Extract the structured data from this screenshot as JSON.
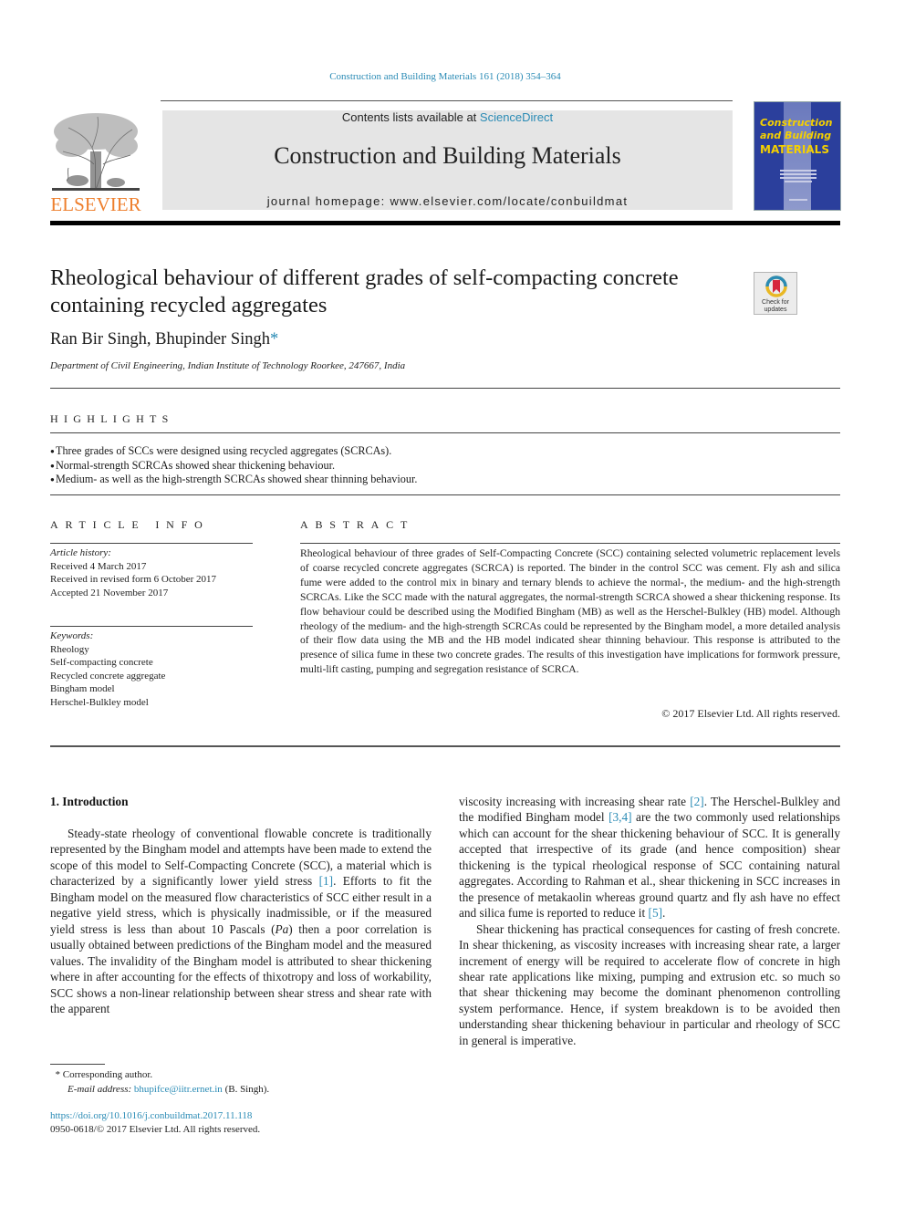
{
  "header": {
    "citation": "Construction and Building Materials 161 (2018) 354–364",
    "contents_prefix": "Contents lists available at ",
    "contents_link": "ScienceDirect",
    "journal_title": "Construction and Building Materials",
    "homepage_label": "journal homepage: ",
    "homepage_url": "www.elsevier.com/locate/conbuildmat",
    "publisher_logo_text": "ELSEVIER",
    "cover": {
      "line1": "Construction",
      "line2": "and Building",
      "line3": "MATERIALS"
    },
    "colors": {
      "link": "#2a8bb5",
      "elsevier_orange": "#ee7f2d",
      "cover_blue": "#2b3f9c",
      "cover_yellow": "#f5d000",
      "masthead_gray": "#e5e5e5"
    }
  },
  "article": {
    "title": "Rheological behaviour of different grades of self-compacting concrete containing recycled aggregates",
    "check_updates_line1": "Check for",
    "check_updates_line2": "updates",
    "authors": "Ran Bir Singh, Bhupinder Singh",
    "corresponding_mark": "*",
    "affiliation": "Department of Civil Engineering, Indian Institute of Technology Roorkee, 247667, India"
  },
  "highlights": {
    "label": "HIGHLIGHTS",
    "items": [
      "Three grades of SCCs were designed using recycled aggregates (SCRCAs).",
      "Normal-strength SCRCAs showed shear thickening behaviour.",
      "Medium- as well as the high-strength SCRCAs showed shear thinning behaviour."
    ]
  },
  "article_info": {
    "label": "ARTICLE INFO",
    "history_label": "Article history:",
    "history": [
      "Received 4 March 2017",
      "Received in revised form 6 October 2017",
      "Accepted 21 November 2017"
    ],
    "keywords_label": "Keywords:",
    "keywords": [
      "Rheology",
      "Self-compacting concrete",
      "Recycled concrete aggregate",
      "Bingham model",
      "Herschel-Bulkley model"
    ]
  },
  "abstract": {
    "label": "ABSTRACT",
    "text": "Rheological behaviour of three grades of Self-Compacting Concrete (SCC) containing selected volumetric replacement levels of coarse recycled concrete aggregates (SCRCA) is reported. The binder in the control SCC was cement. Fly ash and silica fume were added to the control mix in binary and ternary blends to achieve the normal-, the medium- and the high-strength SCRCAs. Like the SCC made with the natural aggregates, the normal-strength SCRCA showed a shear thickening response. Its flow behaviour could be described using the Modified Bingham (MB) as well as the Herschel-Bulkley (HB) model. Although rheology of the medium- and the high-strength SCRCAs could be represented by the Bingham model, a more detailed analysis of their flow data using the MB and the HB model indicated shear thinning behaviour. This response is attributed to the presence of silica fume in these two concrete grades. The results of this investigation have implications for formwork pressure, multi-lift casting, pumping and segregation resistance of SCRCA.",
    "copyright": "© 2017 Elsevier Ltd. All rights reserved."
  },
  "introduction": {
    "heading": "1. Introduction",
    "left_p1_a": "Steady-state rheology of conventional flowable concrete is traditionally represented by the Bingham model and attempts have been made to extend the scope of this model to Self-Compacting Concrete (SCC), a material which is characterized by a significantly lower yield stress ",
    "ref1": "[1]",
    "left_p1_b": ". Efforts to fit the Bingham model on the measured flow characteristics of SCC either result in a negative yield stress, which is physically inadmissible, or if the measured yield stress is less than about 10 Pascals (",
    "pa": "Pa",
    "left_p1_c": ") then a poor correlation is usually obtained between predictions of the Bingham model and the measured values. The invalidity of the Bingham model is attributed to shear thickening where in after accounting for the effects of thixotropy and loss of workability, SCC shows a non-linear relationship between shear stress and shear rate with the apparent",
    "right_p1_a": "viscosity increasing with increasing shear rate ",
    "ref2": "[2]",
    "right_p1_b": ". The Herschel-Bulkley and the modified Bingham model ",
    "ref34": "[3,4]",
    "right_p1_c": " are the two commonly used relationships which can account for the shear thickening behaviour of SCC. It is generally accepted that irrespective of its grade (and hence composition) shear thickening is the typical rheological response of SCC containing natural aggregates. According to Rahman et al., shear thickening in SCC increases in the presence of metakaolin whereas ground quartz and fly ash have no effect and silica fume is reported to reduce it ",
    "ref5": "[5]",
    "right_p1_d": ".",
    "right_p2": "Shear thickening has practical consequences for casting of fresh concrete. In shear thickening, as viscosity increases with increasing shear rate, a larger increment of energy will be required to accelerate flow of concrete in high shear rate applications like mixing, pumping and extrusion etc. so much so that shear thickening may become the dominant phenomenon controlling system performance. Hence, if system breakdown is to be avoided then understanding shear thickening behaviour in particular and rheology of SCC in general is imperative."
  },
  "footnote": {
    "mark": "*",
    "corresponding": "Corresponding author.",
    "email_label": "E-mail address:",
    "email": "bhupifce@iitr.ernet.in",
    "email_suffix": " (B. Singh).",
    "doi": "https://doi.org/10.1016/j.conbuildmat.2017.11.118",
    "issn_copyright": "0950-0618/© 2017 Elsevier Ltd. All rights reserved."
  }
}
